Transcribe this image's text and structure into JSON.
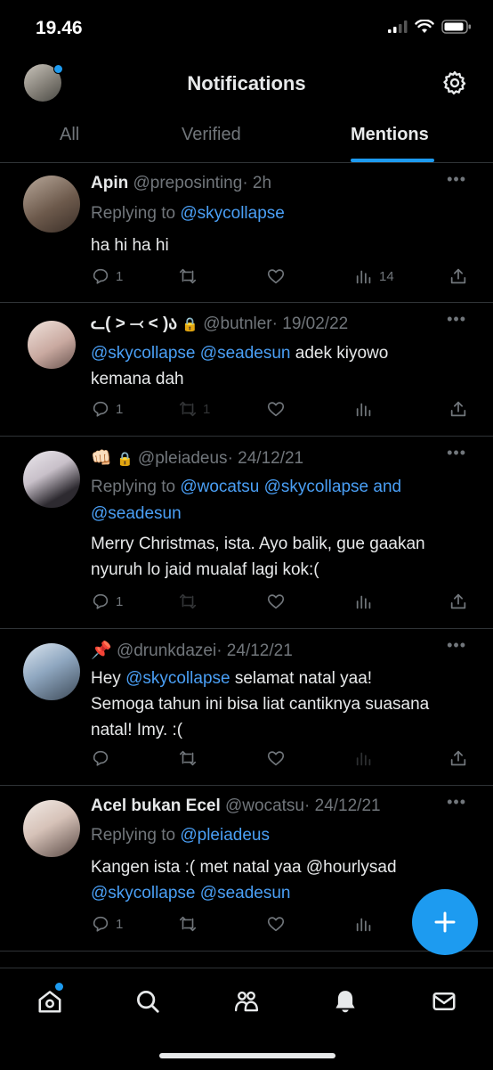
{
  "status": {
    "time": "19.46"
  },
  "header": {
    "title": "Notifications"
  },
  "tabs": [
    {
      "label": "All"
    },
    {
      "label": "Verified"
    },
    {
      "label": "Mentions"
    }
  ],
  "tweets": [
    {
      "name": "Apin",
      "handle": "@preposinting",
      "time": "· 2h",
      "reply_prefix": "Replying to",
      "reply_to": "@skycollapse",
      "text": "ha hi ha hi",
      "replies": "1",
      "retweets": "",
      "views": "14"
    },
    {
      "name": "ᓚ( ˃ ⤙ ˂ )ა",
      "handle": "@butnler",
      "time": "· 19/02/22",
      "mention1": "@skycollapse",
      "mention2": "@seadesun",
      "text_a": "adek kiyowo",
      "text_b": "kemana dah",
      "replies": "1",
      "retweets": "1"
    },
    {
      "name": "👊🏻",
      "handle": "@pleiadeus",
      "time": "· 24/12/21",
      "reply_prefix": "Replying to",
      "reply_to": "@wocatsu @skycollapse and",
      "reply_to2": "@seadesun",
      "text": "Merry Christmas, ista. Ayo balik, gue gaakan nyuruh lo jaid mualaf lagi kok:(",
      "replies": "1"
    },
    {
      "name": "📌",
      "handle": "@drunkdazei",
      "time": "· 24/12/21",
      "text_a": "Hey",
      "mention": "@skycollapse",
      "text_b": "selamat natal yaa!",
      "text_c": "Semoga tahun ini bisa liat cantiknya suasana natal! Imy. :("
    },
    {
      "name": "Acel bukan Ecel",
      "handle": "@wocatsu",
      "time": "· 24/12/21",
      "reply_prefix": "Replying to",
      "reply_to": "@pleiadeus",
      "text_a": "Kangen ista :( met natal yaa @hourlysad",
      "mention1": "@skycollapse",
      "mention2": "@seadesun",
      "replies": "1"
    }
  ],
  "colors": {
    "accent": "#1d9bf0",
    "link": "#4a9ff5",
    "muted": "#71767b",
    "text": "#e7e9ea",
    "divider": "#2f3336"
  },
  "icons": [
    "home-icon",
    "search-icon",
    "communities-icon",
    "notifications-icon",
    "messages-icon",
    "settings-icon",
    "compose-plus-icon"
  ]
}
